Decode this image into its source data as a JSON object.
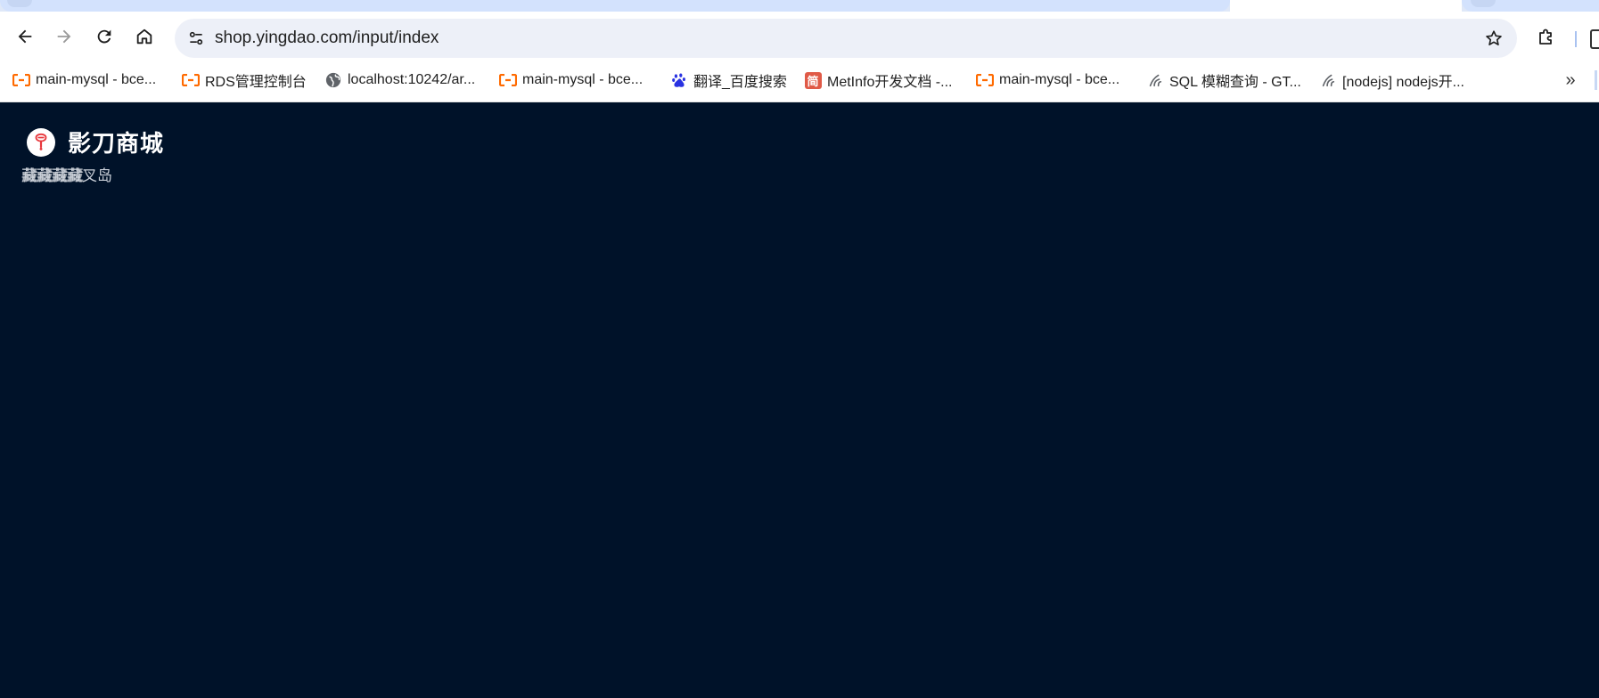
{
  "browser": {
    "url": "shop.yingdao.com/input/index",
    "bookmarks": [
      {
        "label": "main-mysql - bce...",
        "icon": "aliyun-icon"
      },
      {
        "label": "RDS管理控制台",
        "icon": "aliyun-icon"
      },
      {
        "label": "localhost:10242/ar...",
        "icon": "globe-icon"
      },
      {
        "label": "main-mysql - bce...",
        "icon": "aliyun-icon"
      },
      {
        "label": "翻译_百度搜索",
        "icon": "baidu-paw-icon"
      },
      {
        "label": "MetInfo开发文档 -...",
        "icon": "jian-icon"
      },
      {
        "label": "main-mysql - bce...",
        "icon": "aliyun-icon"
      },
      {
        "label": "SQL 模糊查询 - GT...",
        "icon": "gitee-icon"
      },
      {
        "label": "[nodejs] nodejs开...",
        "icon": "gitee-icon"
      }
    ],
    "more_label": "»"
  },
  "page": {
    "brand_name": "影刀商城",
    "overlapping_text": [
      "藏藏藏藏",
      "藏藏藏藏",
      "藏藏藏藏",
      "藏藏藏藏叉岛"
    ]
  },
  "colors": {
    "page_bg": "#001229",
    "aliyun": "#ff6a00",
    "logo_red": "#e8383d",
    "baidu": "#2932e1",
    "jian": "#e05a47"
  }
}
